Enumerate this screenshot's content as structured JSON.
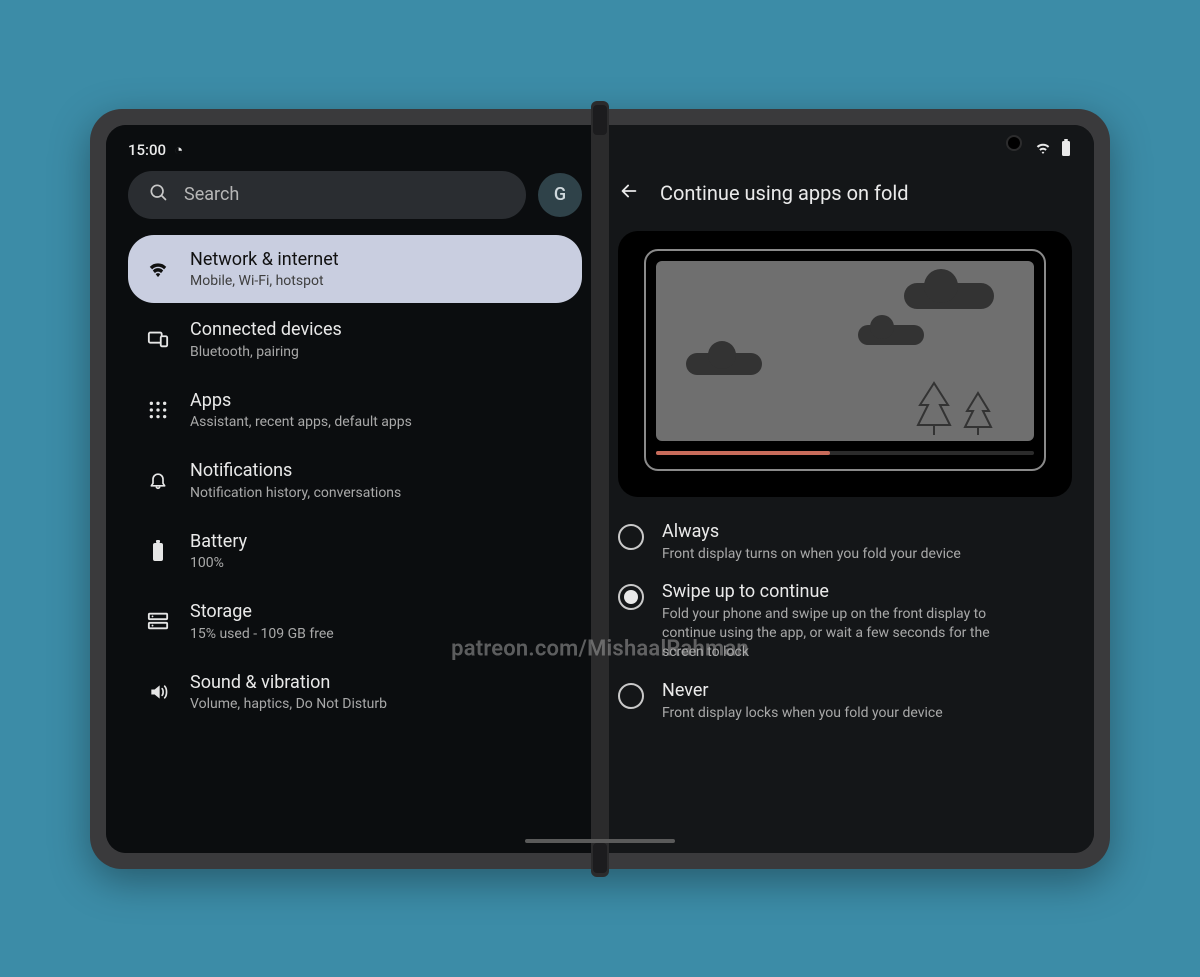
{
  "status": {
    "time": "15:00",
    "clock_icon": "◔"
  },
  "search": {
    "placeholder": "Search",
    "avatar_initial": "G"
  },
  "settings": [
    {
      "id": "network",
      "title": "Network & internet",
      "subtitle": "Mobile, Wi-Fi, hotspot",
      "icon": "wifi",
      "selected": true
    },
    {
      "id": "connected",
      "title": "Connected devices",
      "subtitle": "Bluetooth, pairing",
      "icon": "devices",
      "selected": false
    },
    {
      "id": "apps",
      "title": "Apps",
      "subtitle": "Assistant, recent apps, default apps",
      "icon": "apps",
      "selected": false
    },
    {
      "id": "notifications",
      "title": "Notifications",
      "subtitle": "Notification history, conversations",
      "icon": "bell",
      "selected": false
    },
    {
      "id": "battery",
      "title": "Battery",
      "subtitle": "100%",
      "icon": "battery",
      "selected": false
    },
    {
      "id": "storage",
      "title": "Storage",
      "subtitle": "15% used - 109 GB free",
      "icon": "storage",
      "selected": false
    },
    {
      "id": "sound",
      "title": "Sound & vibration",
      "subtitle": "Volume, haptics, Do Not Disturb",
      "icon": "volume",
      "selected": false
    }
  ],
  "detail": {
    "title": "Continue using apps on fold",
    "options": [
      {
        "id": "always",
        "title": "Always",
        "desc": "Front display turns on when you fold your device",
        "selected": false
      },
      {
        "id": "swipe",
        "title": "Swipe up to continue",
        "desc": "Fold your phone and swipe up on the front display to continue using the app, or wait a few seconds for the screen to lock",
        "selected": true
      },
      {
        "id": "never",
        "title": "Never",
        "desc": "Front display locks when you fold your device",
        "selected": false
      }
    ]
  },
  "watermark": "patreon.com/MishaalRahman"
}
